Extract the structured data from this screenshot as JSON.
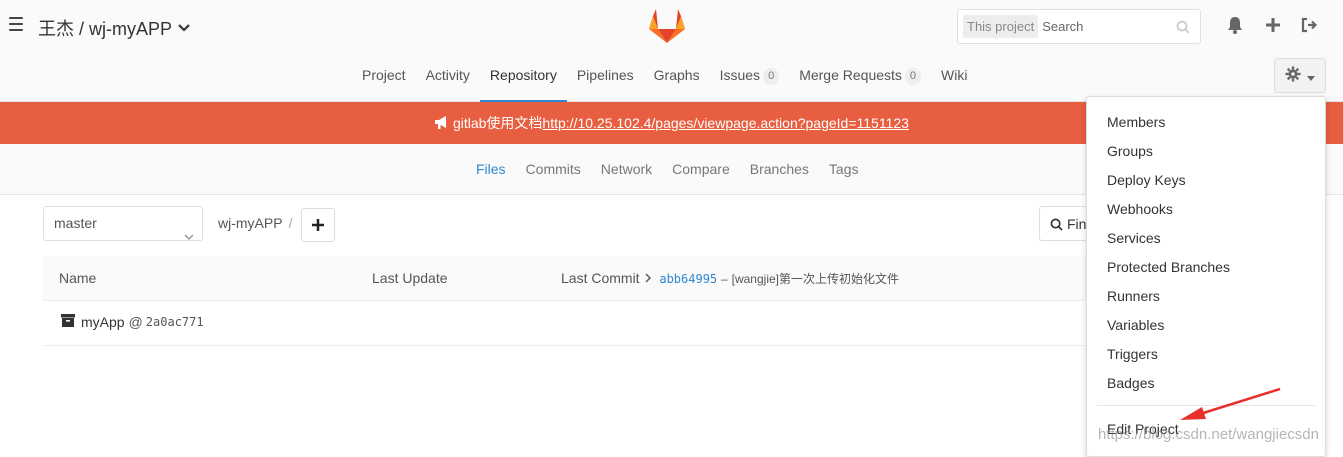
{
  "header": {
    "project_title": "王杰 / wj-myAPP",
    "search": {
      "scope": "This project",
      "placeholder": "Search"
    }
  },
  "nav": {
    "tabs": [
      {
        "label": "Project"
      },
      {
        "label": "Activity"
      },
      {
        "label": "Repository",
        "active": true
      },
      {
        "label": "Pipelines"
      },
      {
        "label": "Graphs"
      },
      {
        "label": "Issues",
        "badge": "0"
      },
      {
        "label": "Merge Requests",
        "badge": "0"
      },
      {
        "label": "Wiki"
      }
    ]
  },
  "broadcast": {
    "prefix": "gitlab使用文档",
    "link": "http://10.25.102.4/pages/viewpage.action?pageId=1151123"
  },
  "sub_nav": {
    "tabs": [
      {
        "label": "Files",
        "active": true
      },
      {
        "label": "Commits"
      },
      {
        "label": "Network"
      },
      {
        "label": "Compare"
      },
      {
        "label": "Branches"
      },
      {
        "label": "Tags"
      }
    ]
  },
  "tree": {
    "branch": "master",
    "breadcrumb": "wj-myAPP",
    "breadcrumb_sep": "/",
    "find_label": "Fin",
    "columns": {
      "name": "Name",
      "last_update": "Last Update",
      "last_commit": "Last Commit"
    },
    "last_commit": {
      "id": "abb64995",
      "dash": "–",
      "message": "[wangjie]第一次上传初始化文件"
    },
    "rows": [
      {
        "name": "myApp",
        "at": "@",
        "hash": "2a0ac771"
      }
    ]
  },
  "settings_menu": {
    "items": [
      "Members",
      "Groups",
      "Deploy Keys",
      "Webhooks",
      "Services",
      "Protected Branches",
      "Runners",
      "Variables",
      "Triggers",
      "Badges"
    ],
    "edit": "Edit Project"
  },
  "watermark": "https://blog.csdn.net/wangjiecsdn",
  "colors": {
    "broadcast": "#e75e40",
    "accent": "#2f88d0"
  }
}
